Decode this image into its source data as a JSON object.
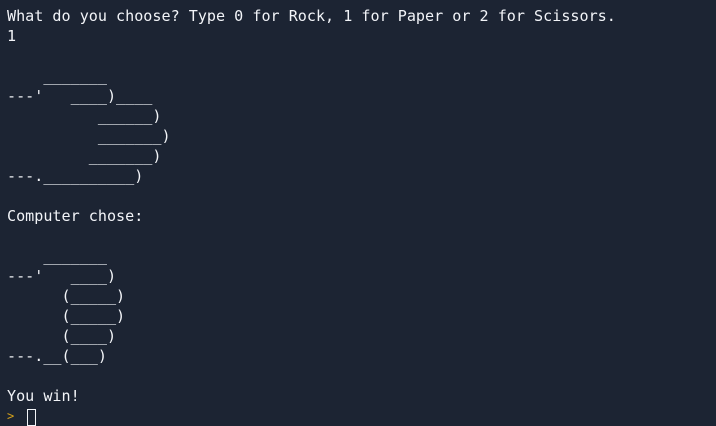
{
  "terminal": {
    "lines": [
      "What do you choose? Type 0 for Rock, 1 for Paper or 2 for Scissors.",
      "1",
      "",
      "    _______",
      "---'   ____)____",
      "          ______)",
      "          _______)",
      "         _______)",
      "---.__________)",
      "",
      "Computer chose:",
      "",
      "    _______",
      "---'   ____)",
      "      (_____)",
      "      (_____)",
      "      (____)",
      "---.__(___)",
      "",
      "You win!"
    ],
    "prompt_symbol": ">"
  }
}
